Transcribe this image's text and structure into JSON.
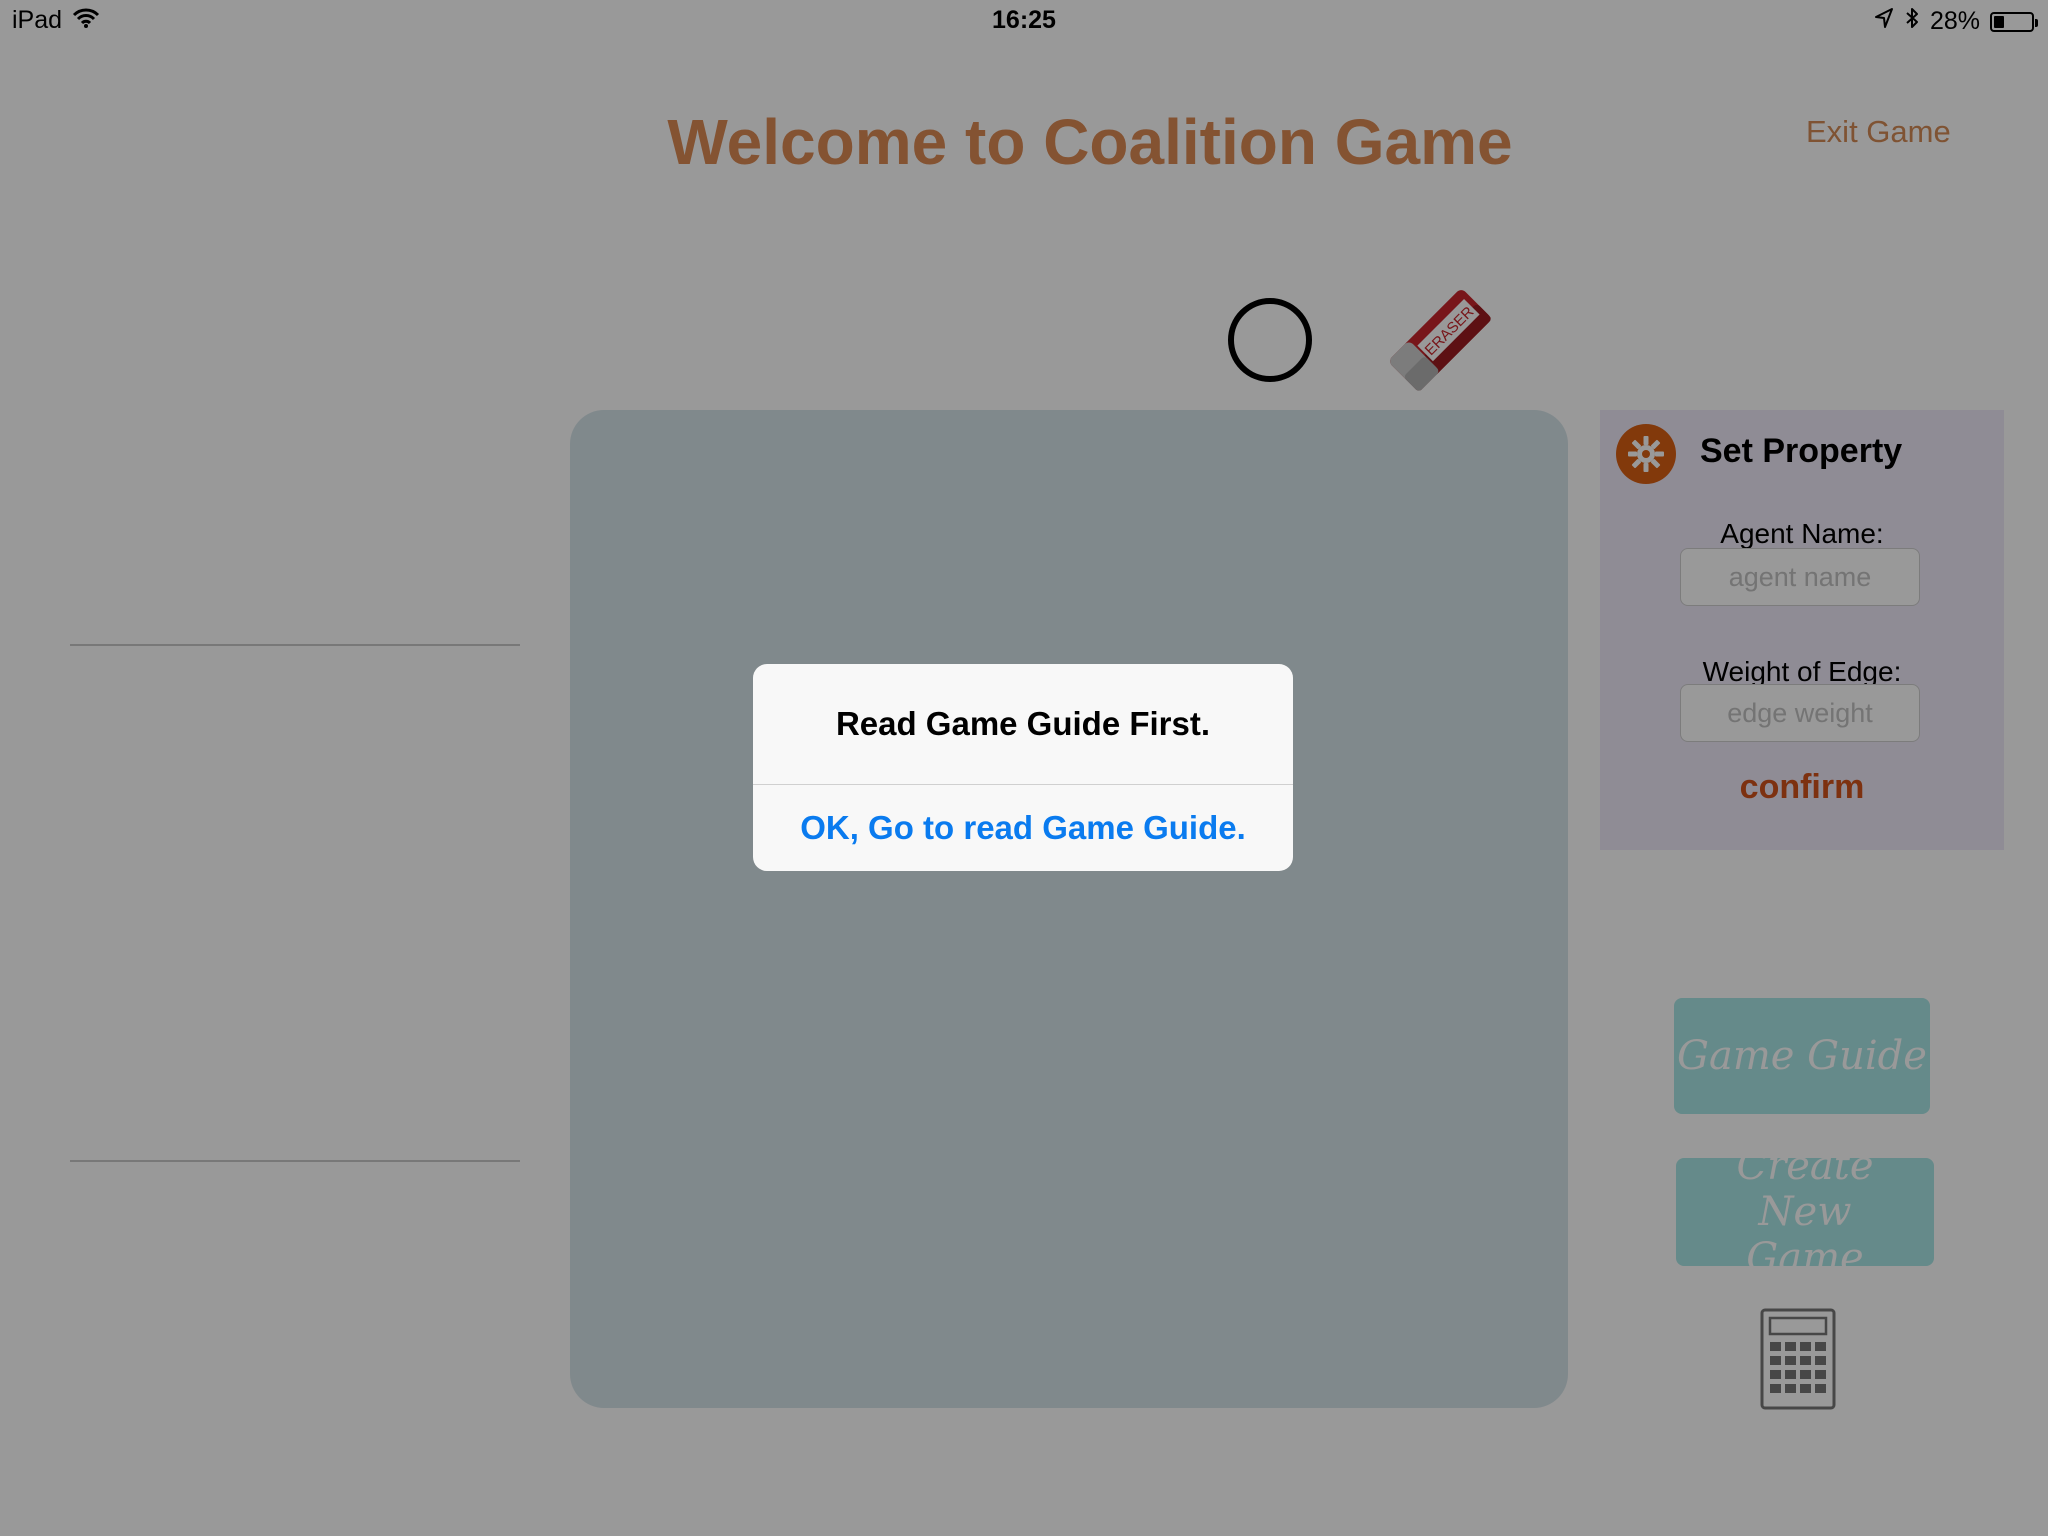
{
  "status_bar": {
    "device": "iPad",
    "time": "16:25",
    "battery_text": "28%",
    "battery_level": 0.28,
    "icons": [
      "wifi-icon",
      "location-arrow-icon",
      "bluetooth-icon",
      "battery-icon"
    ]
  },
  "header": {
    "title": "Welcome to Coalition Game",
    "exit_label": "Exit Game"
  },
  "tools": {
    "node_tool": "circle-icon",
    "eraser_label": "ERASER"
  },
  "property_panel": {
    "title": "Set Property",
    "agent_name_label": "Agent Name:",
    "agent_name_placeholder": "agent name",
    "agent_name_value": "",
    "edge_weight_label": "Weight of Edge:",
    "edge_weight_placeholder": "edge weight",
    "edge_weight_value": "",
    "confirm_label": "confirm"
  },
  "side_buttons": {
    "game_guide_label": "Game Guide",
    "create_game_label": "Create New Game",
    "calculator_icon": "calculator-icon"
  },
  "alert": {
    "message": "Read Game Guide First.",
    "button_label": "OK, Go to read Game Guide."
  },
  "colors": {
    "title": "#dd8a54",
    "accent": "#d95f13",
    "confirm": "#d0531b",
    "button_bg": "#a9e7e6",
    "canvas_bg": "#d6e4ea",
    "panel_bg": "#efe9f9",
    "alert_link": "#0a7bef"
  }
}
